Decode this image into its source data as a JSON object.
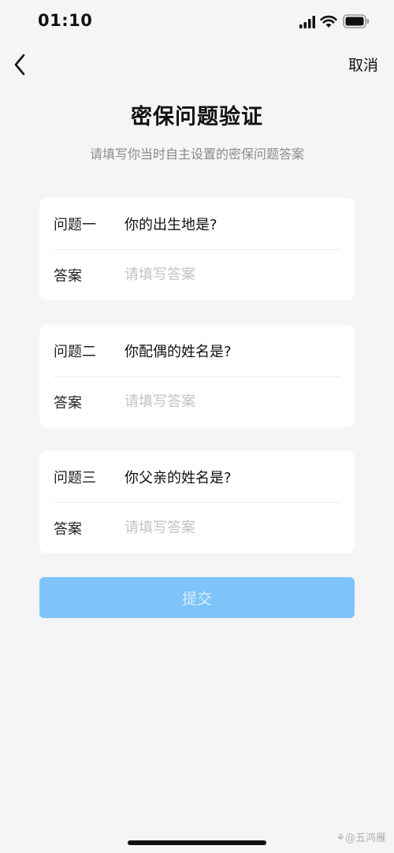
{
  "status_bar": {
    "time": "01:10"
  },
  "nav": {
    "cancel_label": "取消"
  },
  "header": {
    "title": "密保问题验证",
    "subtitle": "请填写你当时自主设置的密保问题答案"
  },
  "questions": [
    {
      "label": "问题一",
      "question": "你的出生地是?",
      "answer_label": "答案",
      "answer_placeholder": "请填写答案"
    },
    {
      "label": "问题二",
      "question": "你配偶的姓名是?",
      "answer_label": "答案",
      "answer_placeholder": "请填写答案"
    },
    {
      "label": "问题三",
      "question": "你父亲的姓名是?",
      "answer_label": "答案",
      "answer_placeholder": "请填写答案"
    }
  ],
  "submit_label": "提交",
  "watermark": "⚘@五鸿雁",
  "colors": {
    "background": "#f5f5f5",
    "card": "#ffffff",
    "submit_disabled": "#7cc4fa",
    "placeholder": "#c3c3c3"
  }
}
